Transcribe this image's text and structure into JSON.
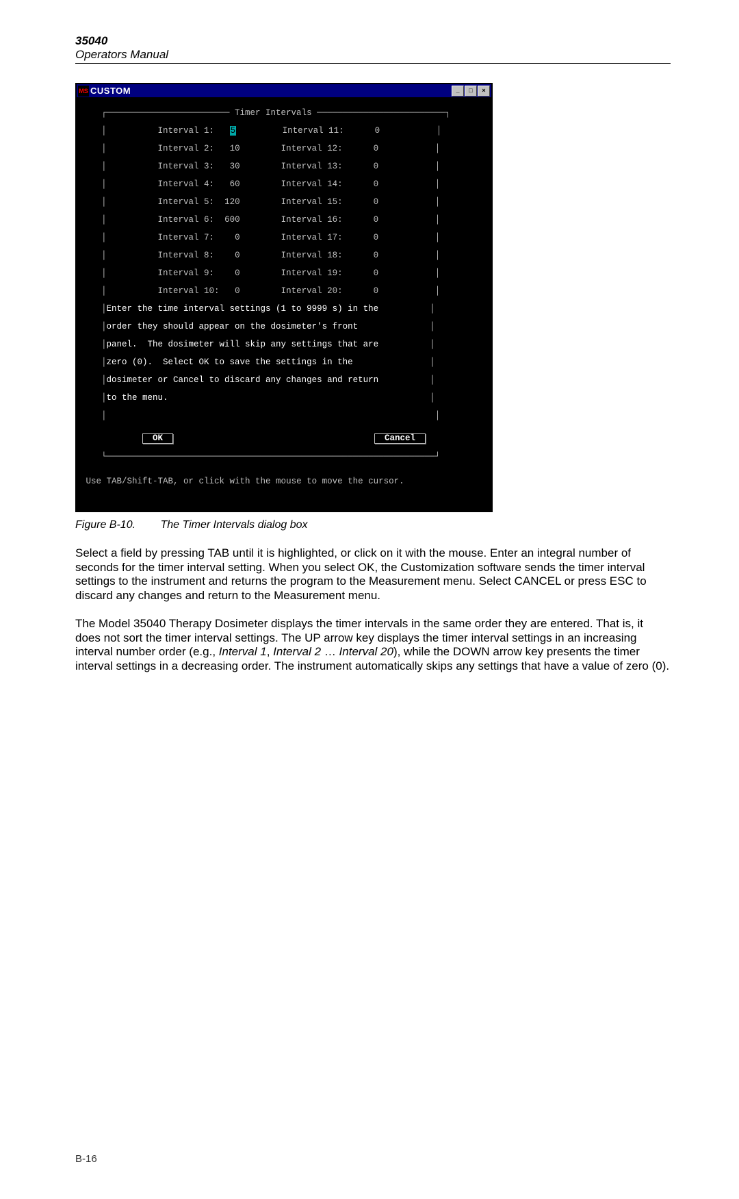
{
  "header": {
    "model": "35040",
    "subtitle": "Operators Manual"
  },
  "window": {
    "title": "CUSTOM",
    "sysicon_text": "MS",
    "buttons": {
      "min": "_",
      "max": "□",
      "close": "×"
    }
  },
  "dialog": {
    "frame_title": "Timer Intervals",
    "left_intervals": [
      {
        "label": "Interval 1:",
        "value": "5",
        "highlight": true
      },
      {
        "label": "Interval 2:",
        "value": "10"
      },
      {
        "label": "Interval 3:",
        "value": "30"
      },
      {
        "label": "Interval 4:",
        "value": "60"
      },
      {
        "label": "Interval 5:",
        "value": "120"
      },
      {
        "label": "Interval 6:",
        "value": "600"
      },
      {
        "label": "Interval 7:",
        "value": "0"
      },
      {
        "label": "Interval 8:",
        "value": "0"
      },
      {
        "label": "Interval 9:",
        "value": "0"
      },
      {
        "label": "Interval 10:",
        "value": "0"
      }
    ],
    "right_intervals": [
      {
        "label": "Interval 11:",
        "value": "0"
      },
      {
        "label": "Interval 12:",
        "value": "0"
      },
      {
        "label": "Interval 13:",
        "value": "0"
      },
      {
        "label": "Interval 14:",
        "value": "0"
      },
      {
        "label": "Interval 15:",
        "value": "0"
      },
      {
        "label": "Interval 16:",
        "value": "0"
      },
      {
        "label": "Interval 17:",
        "value": "0"
      },
      {
        "label": "Interval 18:",
        "value": "0"
      },
      {
        "label": "Interval 19:",
        "value": "0"
      },
      {
        "label": "Interval 20:",
        "value": "0"
      }
    ],
    "help_lines": [
      "Enter the time interval settings (1 to 9999 s) in the",
      "order they should appear on the dosimeter's front",
      "panel.  The dosimeter will skip any settings that are",
      "zero (0).  Select OK to save the settings in the",
      "dosimeter or Cancel to discard any changes and return",
      "to the menu."
    ],
    "ok_label": "OK",
    "cancel_label": "Cancel",
    "status_line": "Use TAB/Shift-TAB, or click with the mouse to move the cursor."
  },
  "caption": {
    "label": "Figure B-10.",
    "text": "The Timer Intervals dialog box"
  },
  "paragraphs": {
    "p1": "Select a field by pressing TAB until it is highlighted, or click on it with the mouse.  Enter an integral number of seconds for the timer interval setting.  When you select OK, the Customization software sends the timer interval settings to the instrument and returns the program to the Measurement menu.  Select CANCEL or press ESC to discard any changes and return to the Measurement menu.",
    "p2_a": "The Model 35040 Therapy Dosimeter displays the timer intervals in the same order they are entered.  That is, it does not sort the timer interval settings.  The UP arrow key displays the timer interval settings in an increasing interval number order (e.g., ",
    "p2_i1": "Interval 1",
    "p2_b": ", ",
    "p2_i2": "Interval 2",
    "p2_c": " … ",
    "p2_i3": "Interval 20",
    "p2_d": "), while the DOWN arrow key presents the timer interval settings in a decreasing order.  The instrument automatically skips any settings that have a value of zero (0)."
  },
  "footer": {
    "page": "B-16"
  }
}
